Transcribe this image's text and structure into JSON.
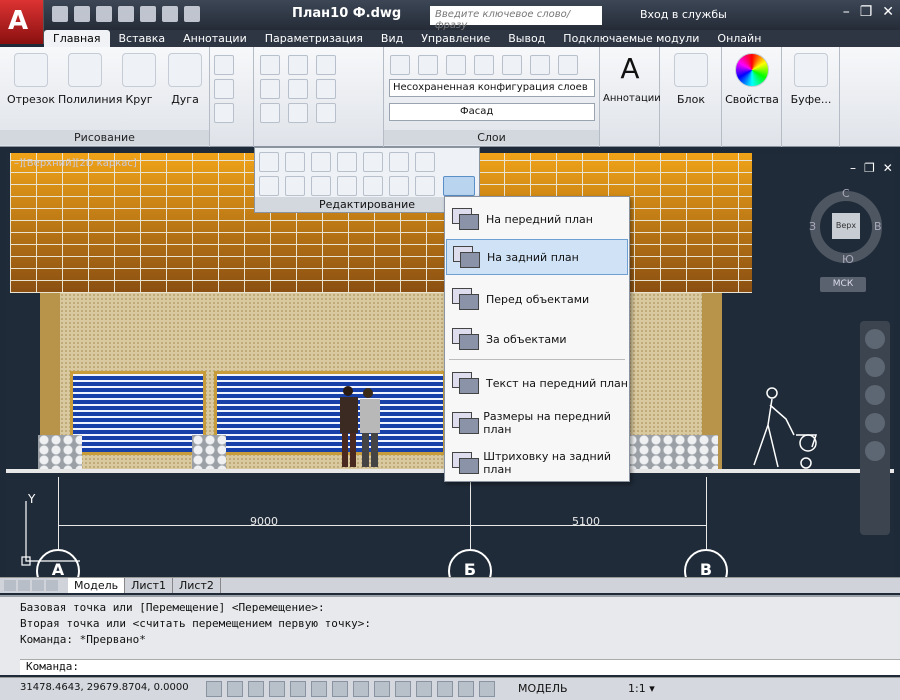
{
  "window": {
    "title": "План10 Ф.dwg",
    "search_placeholder": "Введите ключевое слово/фразу",
    "login": "Вход в службы",
    "controls": [
      "–",
      "❐",
      "✕"
    ]
  },
  "ribbon_tabs": [
    "Главная",
    "Вставка",
    "Аннотации",
    "Параметризация",
    "Вид",
    "Управление",
    "Вывод",
    "Подключаемые модули",
    "Онлайн"
  ],
  "draw_group": {
    "label": "Рисование",
    "buttons": [
      "Отрезок",
      "Полилиния",
      "Круг",
      "Дуга"
    ]
  },
  "layers_group": {
    "label": "Слои",
    "layer_state": "Несохраненная конфигурация слоев",
    "current_layer": "Фасад"
  },
  "big_buttons": [
    "Аннотации",
    "Блок",
    "Свойства",
    "Буфе..."
  ],
  "edit_panel": {
    "label": "Редактирование"
  },
  "draworder_menu": {
    "items": [
      "На передний план",
      "На задний план",
      "Перед объектами",
      "За объектами",
      "Текст на передний план",
      "Размеры на передний план",
      "Штриховку на задний план"
    ],
    "selected": "На задний план"
  },
  "viewport": {
    "label": "–][Верхний][2D каркас]",
    "dims": [
      "9000",
      "5100"
    ],
    "axes": [
      "А",
      "Б",
      "В"
    ]
  },
  "viewcube": {
    "top": "Верх",
    "n": "С",
    "s": "Ю",
    "w": "З",
    "e": "В",
    "ucs": "МСК"
  },
  "layout_tabs": [
    "Модель",
    "Лист1",
    "Лист2"
  ],
  "command_lines": [
    "Базовая точка или [Перемещение] <Перемещение>:",
    "Вторая точка или <считать перемещением первую точку>:",
    "Команда: *Прервано*"
  ],
  "command_prompt": "Команда:",
  "status": {
    "coords": "31478.4643, 29679.8704, 0.0000",
    "model": "МОДЕЛЬ",
    "scale": "1:1"
  }
}
